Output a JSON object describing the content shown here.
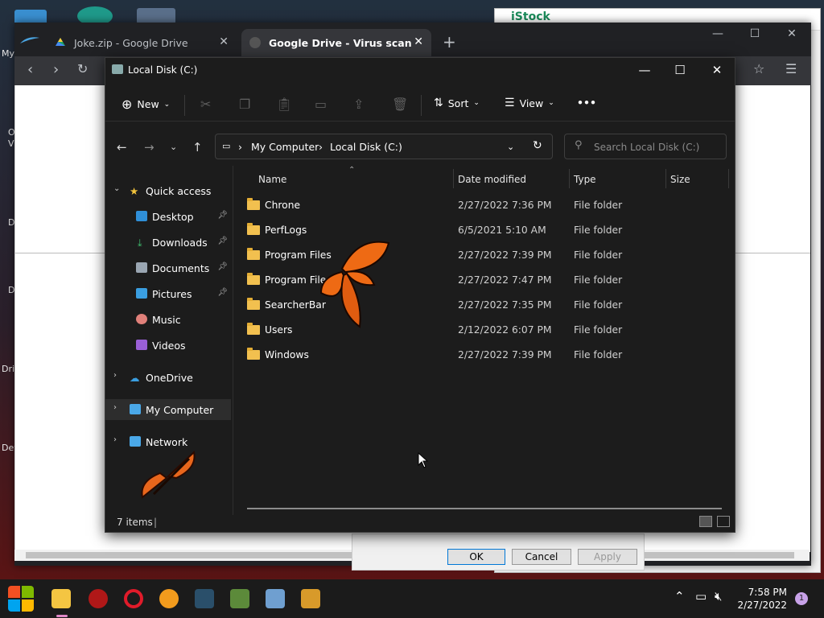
{
  "desktop": {
    "labels": [
      "My",
      "O",
      "V",
      "D",
      "D",
      "Dri",
      "Dev"
    ]
  },
  "background_app": {
    "brand": "iStock"
  },
  "browser": {
    "tabs": [
      {
        "title": "Joke.zip - Google Drive",
        "active": false,
        "icon": "google-drive-icon"
      },
      {
        "title": "Google Drive - Virus scan warn",
        "active": true,
        "icon": "globe-icon"
      }
    ],
    "new_tab": "+",
    "dialog": {
      "ok": "OK",
      "cancel": "Cancel",
      "apply": "Apply"
    }
  },
  "explorer": {
    "title": "Local Disk (C:)",
    "commands": {
      "new": "New",
      "sort": "Sort",
      "view": "View",
      "more": "•••"
    },
    "address": {
      "root": "My Computer",
      "current": "Local Disk (C:)"
    },
    "search": {
      "placeholder": "Search Local Disk (C:)"
    },
    "nav": {
      "quick_access": "Quick access",
      "items": [
        {
          "label": "Desktop",
          "icon": "desktop-icon",
          "pinned": true
        },
        {
          "label": "Downloads",
          "icon": "download-icon",
          "pinned": true
        },
        {
          "label": "Documents",
          "icon": "documents-icon",
          "pinned": true
        },
        {
          "label": "Pictures",
          "icon": "pictures-icon",
          "pinned": true
        },
        {
          "label": "Music",
          "icon": "music-icon",
          "pinned": false
        },
        {
          "label": "Videos",
          "icon": "videos-icon",
          "pinned": false
        }
      ],
      "onedrive": "OneDrive",
      "my_computer": "My Computer",
      "network": "Network"
    },
    "columns": {
      "name": "Name",
      "date": "Date modified",
      "type": "Type",
      "size": "Size"
    },
    "files": [
      {
        "name": "Chrone",
        "date": "2/27/2022 7:36 PM",
        "type": "File folder"
      },
      {
        "name": "PerfLogs",
        "date": "6/5/2021 5:10 AM",
        "type": "File folder"
      },
      {
        "name": "Program Files",
        "date": "2/27/2022 7:39 PM",
        "type": "File folder"
      },
      {
        "name": "Program File",
        "date": "2/27/2022 7:47 PM",
        "type": "File folder"
      },
      {
        "name": "SearcherBar",
        "date": "2/27/2022 7:35 PM",
        "type": "File folder"
      },
      {
        "name": "Users",
        "date": "2/12/2022 6:07 PM",
        "type": "File folder"
      },
      {
        "name": "Windows",
        "date": "2/27/2022 7:39 PM",
        "type": "File folder"
      }
    ],
    "status": "7 items"
  },
  "taskbar": {
    "apps": [
      "windows-start-icon",
      "file-explorer-icon",
      "malware-app-icon",
      "opera-icon",
      "browser-shield-icon",
      "bird-app-icon",
      "minecraft-icon",
      "monitor-app-icon",
      "lock-app-icon"
    ],
    "time": "7:58 PM",
    "date": "2/27/2022",
    "notifications": "1"
  }
}
